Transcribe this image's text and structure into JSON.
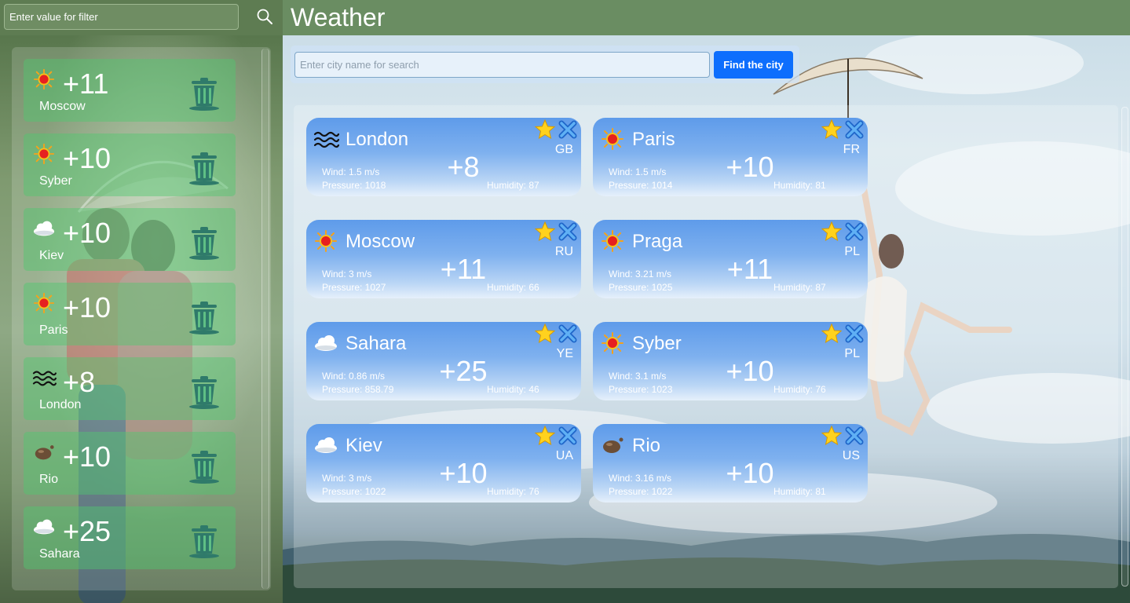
{
  "filter": {
    "placeholder": "Enter value for filter"
  },
  "favorites": [
    {
      "city": "Moscow",
      "temp": "+11",
      "icon": "sun-icon"
    },
    {
      "city": "Syber",
      "temp": "+10",
      "icon": "sun-icon"
    },
    {
      "city": "Kiev",
      "temp": "+10",
      "icon": "cloud-icon"
    },
    {
      "city": "Paris",
      "temp": "+10",
      "icon": "sun-icon"
    },
    {
      "city": "London",
      "temp": "+8",
      "icon": "mist-icon"
    },
    {
      "city": "Rio",
      "temp": "+10",
      "icon": "rain-drop-icon"
    },
    {
      "city": "Sahara",
      "temp": "+25",
      "icon": "cloud-icon"
    }
  ],
  "header": {
    "title": "Weather"
  },
  "search": {
    "placeholder": "Enter city name for search",
    "button_label": "Find the city"
  },
  "cards": [
    {
      "city": "London",
      "country": "GB",
      "temp": "+8",
      "wind": "Wind: 1.5 m/s",
      "pressure": "Pressure: 1018",
      "humidity": "Humidity: 87",
      "icon": "mist-icon"
    },
    {
      "city": "Paris",
      "country": "FR",
      "temp": "+10",
      "wind": "Wind: 1.5 m/s",
      "pressure": "Pressure: 1014",
      "humidity": "Humidity: 81",
      "icon": "sun-icon"
    },
    {
      "city": "Moscow",
      "country": "RU",
      "temp": "+11",
      "wind": "Wind: 3 m/s",
      "pressure": "Pressure: 1027",
      "humidity": "Humidity: 66",
      "icon": "sun-icon"
    },
    {
      "city": "Praga",
      "country": "PL",
      "temp": "+11",
      "wind": "Wind: 3.21 m/s",
      "pressure": "Pressure: 1025",
      "humidity": "Humidity: 87",
      "icon": "sun-icon"
    },
    {
      "city": "Sahara",
      "country": "YE",
      "temp": "+25",
      "wind": "Wind: 0.86 m/s",
      "pressure": "Pressure: 858.79",
      "humidity": "Humidity: 46",
      "icon": "cloud-icon"
    },
    {
      "city": "Syber",
      "country": "PL",
      "temp": "+10",
      "wind": "Wind: 3.1 m/s",
      "pressure": "Pressure: 1023",
      "humidity": "Humidity: 76",
      "icon": "sun-icon"
    },
    {
      "city": "Kiev",
      "country": "UA",
      "temp": "+10",
      "wind": "Wind: 3 m/s",
      "pressure": "Pressure: 1022",
      "humidity": "Humidity: 76",
      "icon": "cloud-icon"
    },
    {
      "city": "Rio",
      "country": "US",
      "temp": "+10",
      "wind": "Wind: 3.16 m/s",
      "pressure": "Pressure: 1022",
      "humidity": "Humidity: 81",
      "icon": "rain-drop-icon"
    }
  ],
  "colors": {
    "header": "#6a8d62",
    "button": "#0d6efd",
    "favorite_card": "#50c86e",
    "weather_card": "#5e9bea"
  }
}
